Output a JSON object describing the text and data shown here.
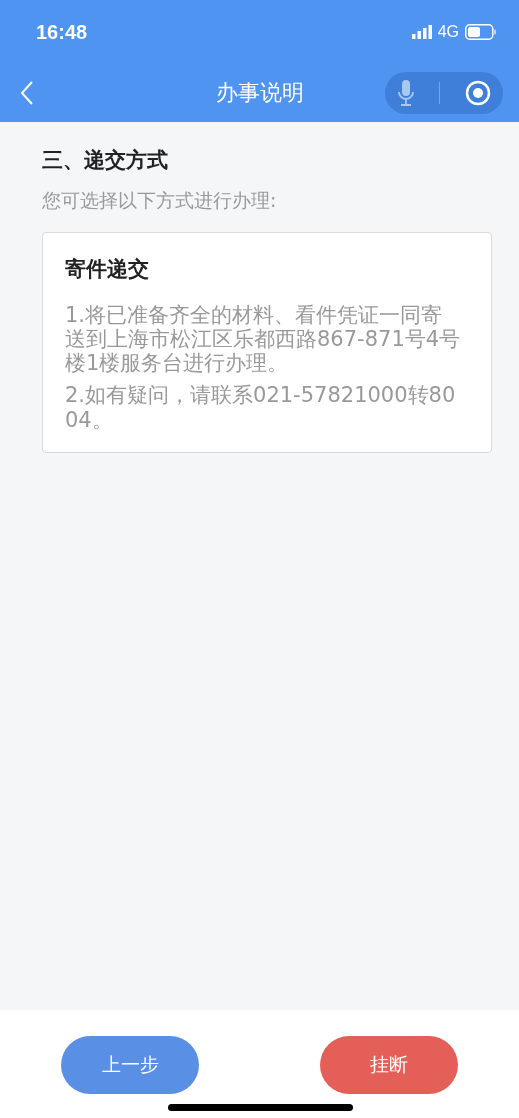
{
  "status_bar": {
    "time": "16:48",
    "network": "4G"
  },
  "nav": {
    "title": "办事说明"
  },
  "section": {
    "heading": "三、递交方式",
    "intro": "您可选择以下方式进行办理:"
  },
  "card": {
    "title": "寄件递交",
    "paragraphs": [
      "1.将已准备齐全的材料、看件凭证一同寄送到上海市松江区乐都西路867-871号4号楼1楼服务台进行办理。",
      "2.如有疑问，请联系021-57821000转8004。"
    ]
  },
  "buttons": [
    {
      "label": "上一步",
      "kind": "primary"
    },
    {
      "label": "挂断",
      "kind": "danger"
    }
  ]
}
